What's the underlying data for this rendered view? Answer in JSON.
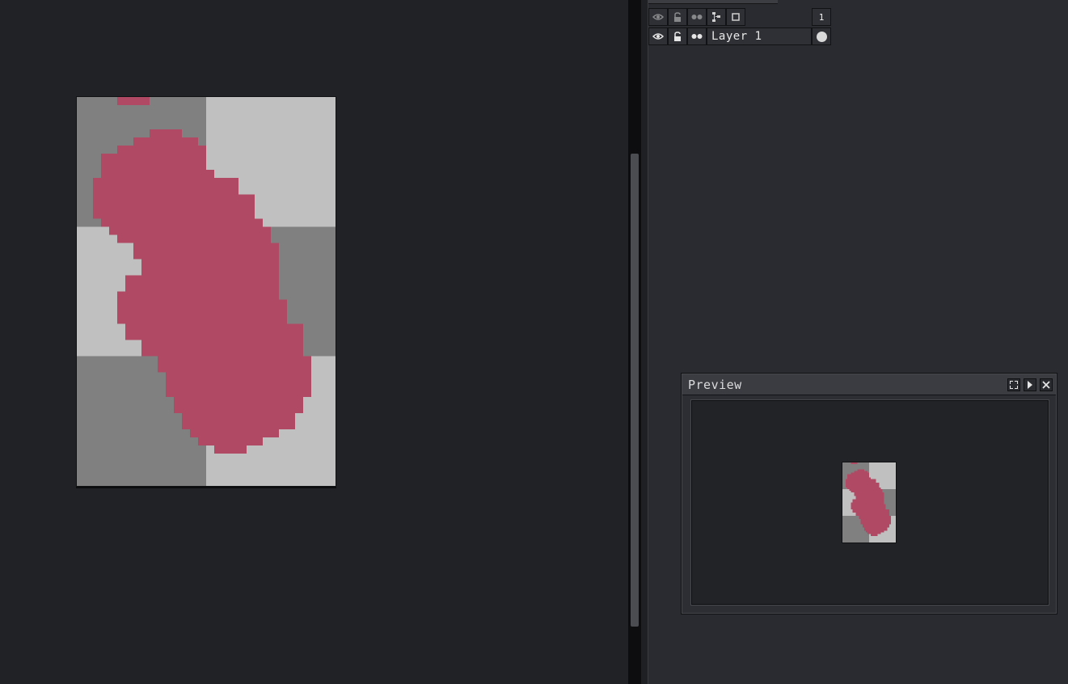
{
  "colors": {
    "workspace_bg": "#212226",
    "panel_bg": "#2a2b30",
    "checker_light": "#c0c0c0",
    "checker_dark": "#808080",
    "paint": "#b04a64"
  },
  "timeline": {
    "header_icons": [
      "eye-icon",
      "lock-icon",
      "continuous-icon",
      "group-icon",
      "frame-icon"
    ],
    "frame_number": "1",
    "layers": [
      {
        "name": "Layer 1",
        "visible_icon": "eye-icon",
        "lock_icon": "lock-icon",
        "continuous_icon": "continuous-icon",
        "cel": "filled-dot"
      }
    ]
  },
  "preview": {
    "title": "Preview",
    "buttons": [
      "fullscreen-icon",
      "play-icon",
      "close-icon"
    ]
  }
}
